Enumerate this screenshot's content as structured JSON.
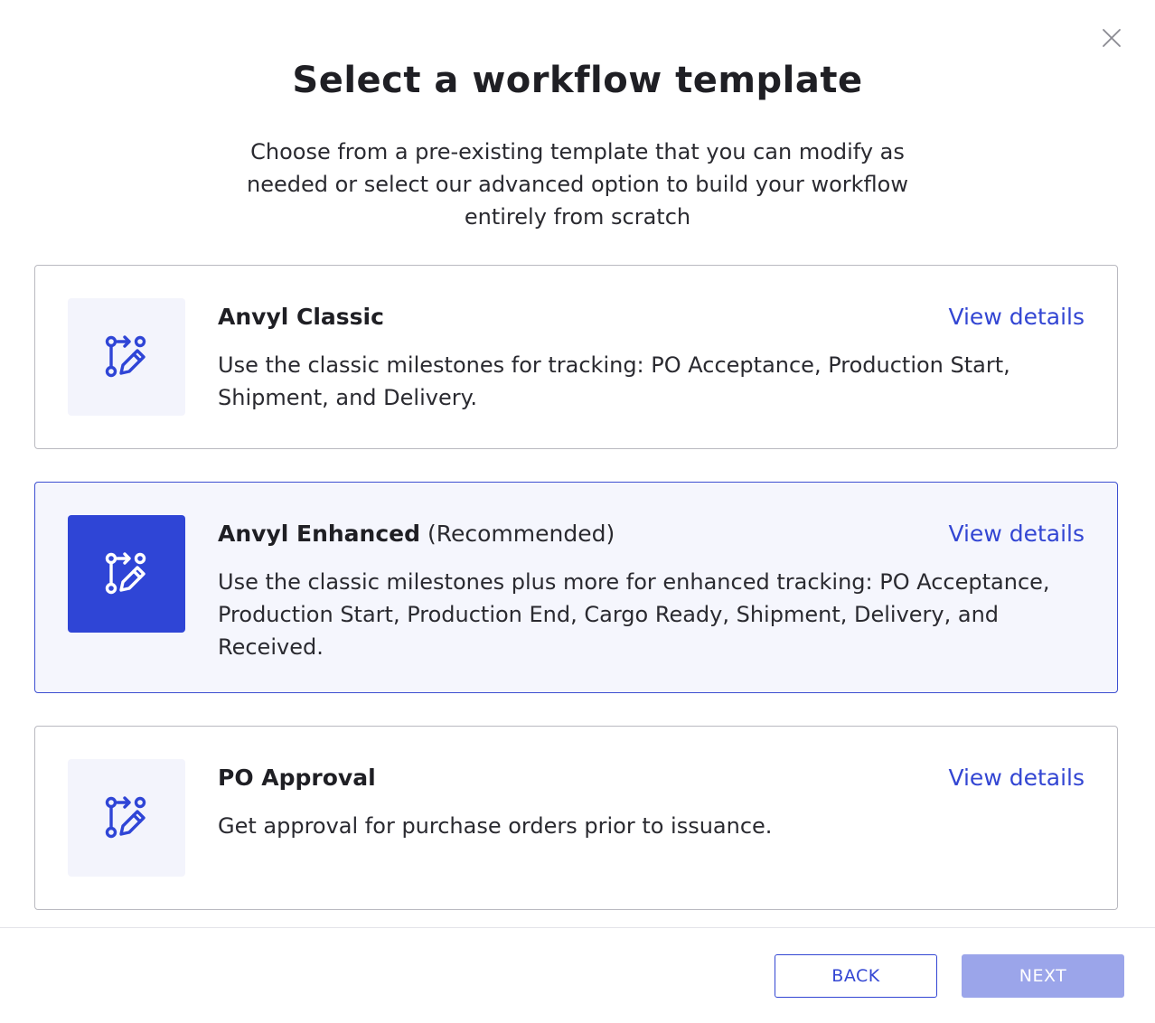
{
  "dialog": {
    "title": "Select a workflow template",
    "subtitle": "Choose from a pre-existing template that you can modify as needed or select our advanced option to build your workflow entirely from scratch",
    "close_icon": "close-icon"
  },
  "templates": [
    {
      "name": "Anvyl Classic",
      "tag": "",
      "description": "Use the classic milestones for tracking: PO Acceptance, Production Start, Shipment, and Delivery.",
      "link_label": "View details",
      "icon": "workflow-edit-icon",
      "selected": false
    },
    {
      "name": "Anvyl Enhanced",
      "tag": "(Recommended)",
      "description": "Use the classic milestones plus more for enhanced tracking: PO Acceptance, Production Start, Production End, Cargo Ready, Shipment, Delivery, and Received.",
      "link_label": "View details",
      "icon": "workflow-edit-icon",
      "selected": true
    },
    {
      "name": "PO Approval",
      "tag": "",
      "description": "Get approval for purchase orders prior to issuance.",
      "link_label": "View details",
      "icon": "workflow-edit-icon",
      "selected": false
    }
  ],
  "footer": {
    "back_label": "BACK",
    "next_label": "NEXT"
  },
  "colors": {
    "accent": "#3346d3",
    "selected_icon_bg": "#2f45d6",
    "selected_card_bg": "#f5f6fd",
    "next_disabled_bg": "#9ba5ea"
  }
}
